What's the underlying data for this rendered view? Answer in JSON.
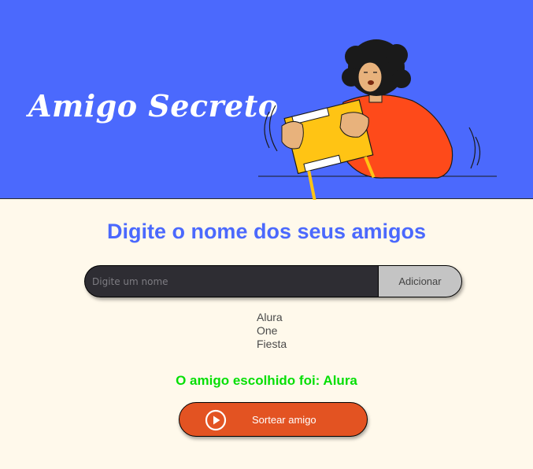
{
  "header": {
    "title": "Amigo Secreto",
    "illustration": "person-holding-gift-box"
  },
  "main": {
    "subtitle": "Digite o nome dos seus amigos",
    "input": {
      "placeholder": "Digite um nome",
      "value": ""
    },
    "add_button_label": "Adicionar",
    "friends": [
      "Alura",
      "One",
      "Fiesta"
    ],
    "result_text": "O amigo escolhido foi: Alura",
    "draw_button_label": "Sortear amigo",
    "draw_button_icon": "play-circle-icon"
  },
  "colors": {
    "header_bg": "#4B69FD",
    "page_bg": "#FFF9EB",
    "subtitle": "#4B69FD",
    "result": "#05DF05",
    "draw_button": "#E35322",
    "input_bg": "#2E2D33",
    "add_button": "#C4C4C4"
  }
}
